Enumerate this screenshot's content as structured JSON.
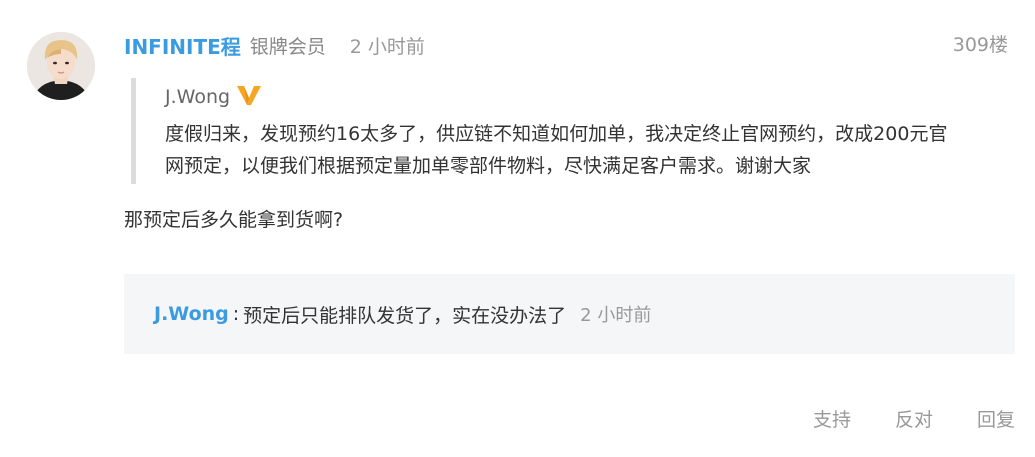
{
  "comment": {
    "user": {
      "name": "INFINITE程",
      "badge": "银牌会员",
      "avatar": "avatar-icon"
    },
    "time": "2 小时前",
    "floor": "309楼",
    "quote": {
      "author": "J.Wong",
      "verified_icon": "verified-v-icon",
      "verified_color": "#f6a623",
      "text": "度假归来，发现预约16太多了，供应链不知道如何加单，我决定终止官网预约，改成200元官网预定，以便我们根据预定量加单零部件物料，尽快满足客户需求。谢谢大家"
    },
    "text": "那预定后多久能拿到货啊?",
    "reply": {
      "user": "J.Wong",
      "separator": ":",
      "text": "预定后只能排队发货了，实在没办法了",
      "time": "2 小时前"
    },
    "actions": {
      "support": "支持",
      "oppose": "反对",
      "reply": "回复"
    }
  },
  "colors": {
    "link": "#3b9be0",
    "muted": "#999999",
    "reply_bg": "#f5f6f7"
  }
}
